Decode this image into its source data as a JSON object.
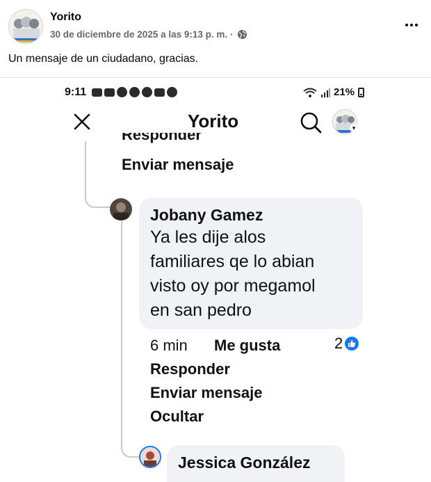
{
  "post": {
    "page_name": "Yorito",
    "timestamp": "30 de diciembre de 2025 a las 9:13 p. m.",
    "separator": "·",
    "privacy_icon": "globe-icon",
    "more_icon": "more-horizontal-icon",
    "text": "Un mensaje de un ciudadano, gracias."
  },
  "screenshot": {
    "status_bar": {
      "time": "9:11",
      "battery": "21%"
    },
    "app_bar": {
      "title": "Yorito",
      "close_icon": "close-icon",
      "search_icon": "search-icon"
    },
    "previous_comment": {
      "cut_action": "Responder",
      "send_message": "Enviar mensaje"
    },
    "comments": [
      {
        "author": "Jobany Gamez",
        "lines": [
          "Ya les dije alos",
          "familiares qe lo abian",
          "visto oy por megamol",
          "en san pedro"
        ],
        "time": "6 min",
        "like_label": "Me gusta",
        "like_count": "2",
        "reply_label": "Responder",
        "message_label": "Enviar mensaje",
        "hide_label": "Ocultar"
      },
      {
        "author": "Jessica González"
      }
    ]
  },
  "colors": {
    "facebook_blue": "#1877f2",
    "bubble_bg": "#f0f2f5",
    "meta_gray": "#65676b",
    "thread_line": "#c6c9ce"
  }
}
